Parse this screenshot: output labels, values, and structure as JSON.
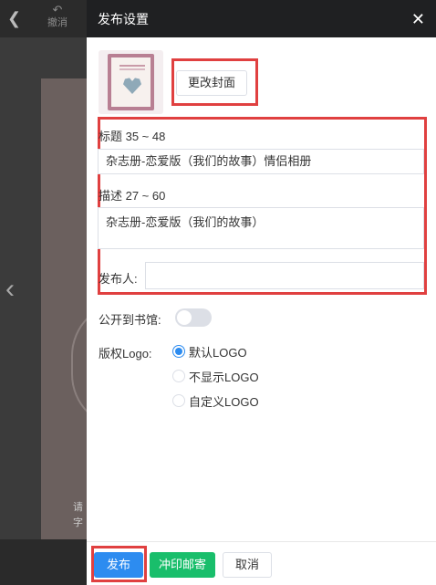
{
  "background": {
    "back_icon": "chevron-left-icon",
    "undo_label": "撤消",
    "side_text": "请\n字"
  },
  "drawer": {
    "title": "发布设置",
    "change_cover_label": "更改封面",
    "title_field": {
      "label": "标题 35 ~ 48",
      "value": "杂志册-恋爱版（我们的故事）情侣相册"
    },
    "description_field": {
      "label": "描述 27 ~ 60",
      "value": "杂志册-恋爱版（我们的故事）"
    },
    "publisher_field": {
      "label": "发布人:",
      "value": ""
    },
    "public_label": "公开到书馆:",
    "public_enabled": false,
    "logo_label": "版权Logo:",
    "logo_options": [
      {
        "label": "默认LOGO",
        "selected": true
      },
      {
        "label": "不显示LOGO",
        "selected": false
      },
      {
        "label": "自定义LOGO",
        "selected": false
      }
    ]
  },
  "footer": {
    "publish_label": "发布",
    "print_label": "冲印邮寄",
    "cancel_label": "取消"
  },
  "colors": {
    "primary": "#2d8cf0",
    "success": "#19be6b",
    "highlight": "#e04040",
    "header": "#1f2022"
  }
}
